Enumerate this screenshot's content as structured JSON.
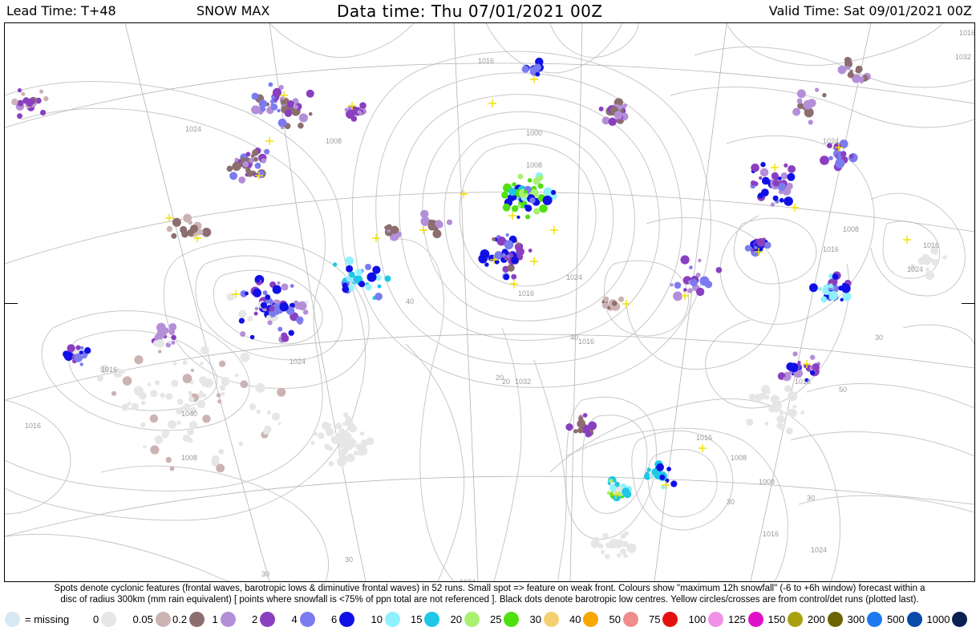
{
  "header": {
    "lead_time": "Lead Time: T+48",
    "field": "SNOW MAX",
    "data_time": "Data time:  Thu 07/01/2021 00Z",
    "valid_time": "Valid Time: Sat 09/01/2021 00Z"
  },
  "caption": {
    "line1": "Spots denote cyclonic features (frontal waves, barotropic lows & diminutive frontal waves) in 52 runs. Small spot => feature on weak front. Colours show \"maximum 12h snowfall\" (-6 to +6h window) forecast within a",
    "line2": "disc of radius 300km (mm rain equivalent) [ points where snowfall is <75% of ppn total are not referenced ]. Black dots denote barotropic low centres. Yellow circles/crosses are from control/det runs (plotted last)."
  },
  "legend": {
    "missing_label": "= missing",
    "missing_color": "#d6e8f2",
    "items": [
      {
        "label": "0",
        "color": "#e6e6e6"
      },
      {
        "label": "0.05",
        "color": "#ccb3b3"
      },
      {
        "label": "0.2",
        "color": "#8c6e6e"
      },
      {
        "label": "1",
        "color": "#b48fd8"
      },
      {
        "label": "2",
        "color": "#8a3fc0"
      },
      {
        "label": "4",
        "color": "#7b7bf0"
      },
      {
        "label": "6",
        "color": "#1010e6"
      },
      {
        "label": "10",
        "color": "#8ff0ff"
      },
      {
        "label": "15",
        "color": "#1ec8e6"
      },
      {
        "label": "20",
        "color": "#a8f070"
      },
      {
        "label": "25",
        "color": "#50e010"
      },
      {
        "label": "30",
        "color": "#f5d070"
      },
      {
        "label": "40",
        "color": "#f5a800"
      },
      {
        "label": "50",
        "color": "#f08c8c"
      },
      {
        "label": "75",
        "color": "#e61010"
      },
      {
        "label": "100",
        "color": "#f090e6"
      },
      {
        "label": "125",
        "color": "#e010c8"
      },
      {
        "label": "150",
        "color": "#a8a010"
      },
      {
        "label": "200",
        "color": "#6b6400"
      },
      {
        "label": "300",
        "color": "#1e78f0"
      },
      {
        "label": "500",
        "color": "#0a4aa8"
      },
      {
        "label": "1000",
        "color": "#0a2050"
      }
    ]
  },
  "map": {
    "isobar_labels": [
      "1000",
      "1008",
      "1016",
      "1024",
      "1032",
      "1008",
      "1016",
      "1016",
      "1024",
      "1016",
      "1008",
      "1016",
      "1024",
      "1016",
      "1008",
      "1024",
      "1016",
      "1032",
      "1016",
      "1024",
      "1040",
      "1024",
      "1008",
      "1016",
      "1024",
      "1016",
      "1008",
      "1016"
    ],
    "graticule_labels": [
      "20",
      "30",
      "50",
      "30",
      "30",
      "40",
      "50",
      "30",
      "20",
      "30",
      "40"
    ]
  }
}
